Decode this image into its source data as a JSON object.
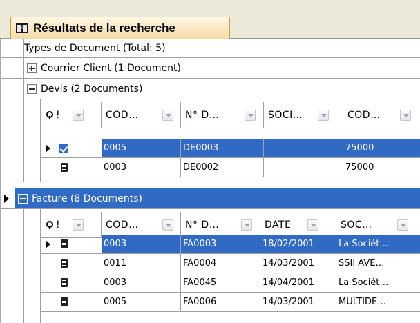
{
  "tab": {
    "title": "Résultats de la recherche"
  },
  "root": {
    "label": "Types de Document (Total: 5)"
  },
  "groups": [
    {
      "label": "Courrier Client (1 Document)",
      "expanded": false
    },
    {
      "label": "Devis  (2 Documents)",
      "expanded": true,
      "columns": [
        "!",
        "COD…",
        "N° D…",
        "SOCI…",
        "COD…"
      ],
      "rows": [
        {
          "c1": "0005",
          "c2": "DE0003",
          "c3": "",
          "c4": "75000",
          "selected": true
        },
        {
          "c1": "0003",
          "c2": "DE0002",
          "c3": "",
          "c4": "75000",
          "selected": false
        }
      ]
    },
    {
      "label": "Facture (8 Documents)",
      "expanded": true,
      "selected": true,
      "columns": [
        "!",
        "COD…",
        "N° D…",
        "DATE",
        "SOC…"
      ],
      "rows": [
        {
          "c1": "0003",
          "c2": "FA0003",
          "c3": "18/02/2001",
          "c4": "La Sociét…",
          "selected": true
        },
        {
          "c1": "0011",
          "c2": "FA0004",
          "c3": "14/03/2001",
          "c4": "SSII AVE…",
          "selected": false
        },
        {
          "c1": "0003",
          "c2": "FA0045",
          "c3": "14/04/2001",
          "c4": "La Sociét…",
          "selected": false
        },
        {
          "c1": "0005",
          "c2": "FA0006",
          "c3": "14/03/2001",
          "c4": "MULTIDE…",
          "selected": false
        }
      ]
    }
  ],
  "colors": {
    "selection": "#316ac5",
    "tab_border": "#d29b3f",
    "grid_line": "#a0a0a0"
  }
}
